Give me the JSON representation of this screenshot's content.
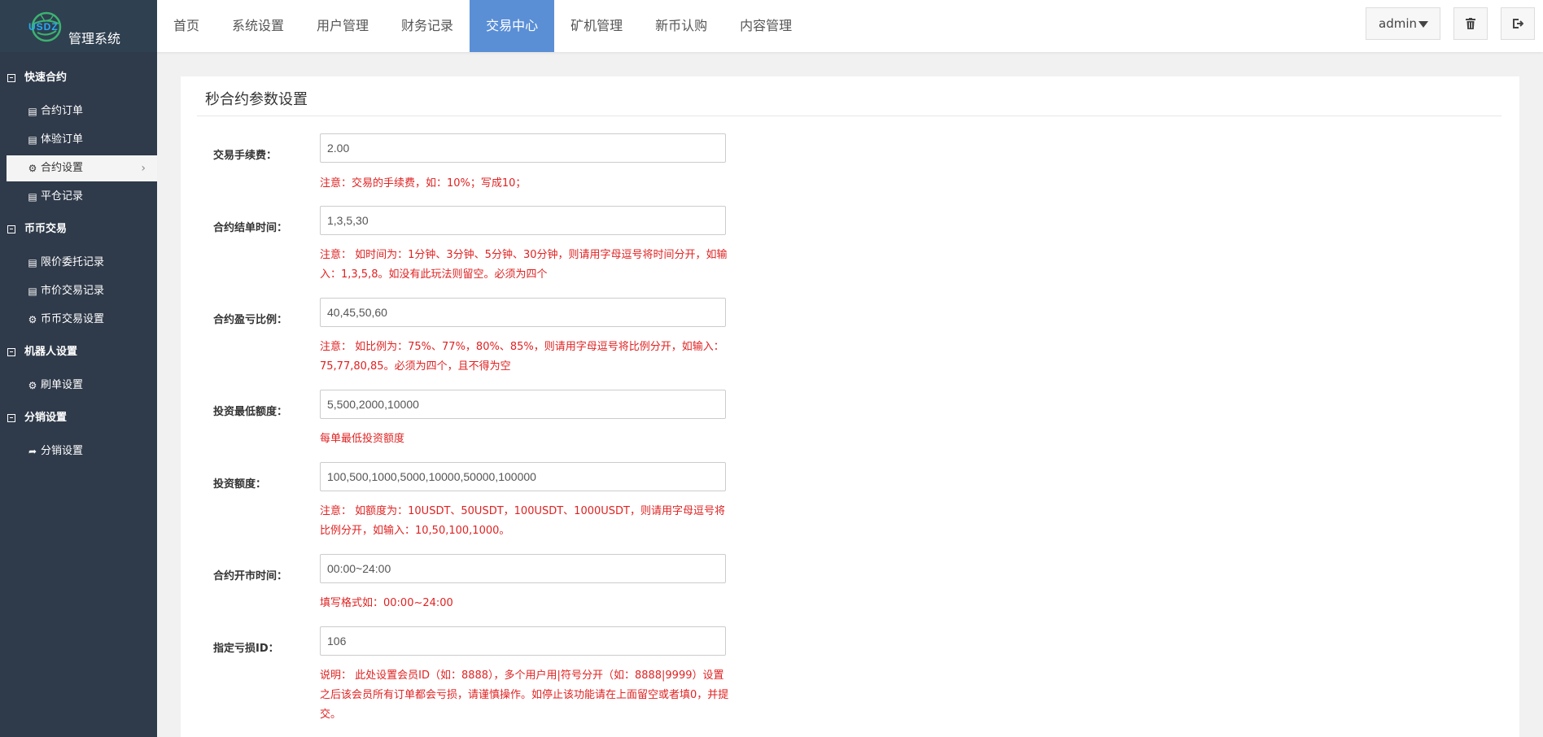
{
  "app": {
    "logo_mark": "USDZ",
    "logo_text": "管理系统"
  },
  "nav": {
    "items": [
      {
        "label": "首页"
      },
      {
        "label": "系统设置"
      },
      {
        "label": "用户管理"
      },
      {
        "label": "财务记录"
      },
      {
        "label": "交易中心",
        "active": true
      },
      {
        "label": "矿机管理"
      },
      {
        "label": "新币认购"
      },
      {
        "label": "内容管理"
      }
    ],
    "active_color": "#5a8fd6"
  },
  "user_menu": {
    "name": "admin",
    "trash_icon": "trash-icon",
    "exit_icon": "sign-out-icon"
  },
  "sidebar": {
    "groups": [
      {
        "label": "快速合约",
        "items": [
          {
            "label": "合约订单",
            "icon": "list-icon"
          },
          {
            "label": "体验订单",
            "icon": "list-icon"
          },
          {
            "label": "合约设置",
            "icon": "gear-icon",
            "active": true
          },
          {
            "label": "平仓记录",
            "icon": "list-icon"
          }
        ]
      },
      {
        "label": "币币交易",
        "items": [
          {
            "label": "限价委托记录",
            "icon": "list-icon"
          },
          {
            "label": "市价交易记录",
            "icon": "list-icon"
          },
          {
            "label": "币币交易设置",
            "icon": "gear-icon"
          }
        ]
      },
      {
        "label": "机器人设置",
        "items": [
          {
            "label": "刷单设置",
            "icon": "gear-icon"
          }
        ]
      },
      {
        "label": "分销设置",
        "items": [
          {
            "label": "分销设置",
            "icon": "share-icon"
          }
        ]
      }
    ],
    "background": "#2f3a4a"
  },
  "panel": {
    "title": "秒合约参数设置",
    "fields": [
      {
        "label": "交易手续费：",
        "value": "2.00",
        "note": "注意：交易的手续费，如：10%；写成10；"
      },
      {
        "label": "合约结单时间：",
        "value": "1,3,5,30",
        "note": "注意： 如时间为：1分钟、3分钟、5分钟、30分钟，则请用字母逗号将时间分开，如输入：1,3,5,8。如没有此玩法则留空。必须为四个"
      },
      {
        "label": "合约盈亏比例：",
        "value": "40,45,50,60",
        "note": "注意： 如比例为：75%、77%，80%、85%，则请用字母逗号将比例分开，如输入：75,77,80,85。必须为四个，且不得为空"
      },
      {
        "label": "投资最低额度：",
        "value": "5,500,2000,10000",
        "note": "每单最低投资额度"
      },
      {
        "label": "投资额度：",
        "value": "100,500,1000,5000,10000,50000,100000",
        "note": "注意： 如额度为：10USDT、50USDT，100USDT、1000USDT，则请用字母逗号将比例分开，如输入：10,50,100,1000。"
      },
      {
        "label": "合约开市时间：",
        "value": "00:00~24:00",
        "note": "填写格式如：00:00~24:00"
      },
      {
        "label": "指定亏损ID：",
        "value": "106",
        "note": "说明： 此处设置会员ID（如：8888），多个用户用|符号分开（如：8888|9999）设置之后该会员所有订单都会亏损，请谨慎操作。如停止该功能请在上面留空或者填0，并提交。"
      }
    ],
    "note_color": "#e02222"
  }
}
